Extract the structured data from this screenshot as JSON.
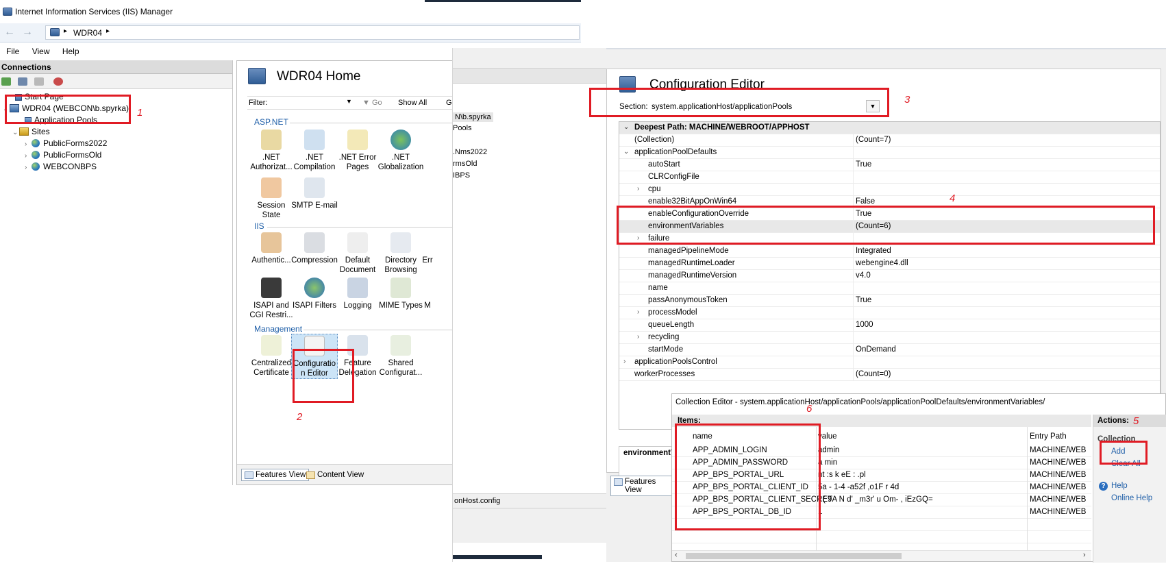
{
  "window": {
    "title": "Internet Information Services (IIS) Manager",
    "address_crumb": "WDR04"
  },
  "menu": [
    "File",
    "View",
    "Help"
  ],
  "connections": {
    "header": "Connections",
    "tree": {
      "start_page": "Start Page",
      "server": "WDR04 (WEBCON\\b.spyrka)",
      "app_pools": "Application Pools",
      "sites": "Sites",
      "site_items": [
        "PublicForms2022",
        "PublicFormsOld",
        "WEBCONBPS"
      ]
    }
  },
  "home": {
    "title": "WDR04 Home",
    "filter_label": "Filter:",
    "go_label": "Go",
    "show_all_label": "Show All",
    "group_label_partial": "Gro",
    "groups": [
      {
        "name": "ASP.NET",
        "features": [
          ".NET Authorizat...",
          ".NET Compilation",
          ".NET Error Pages",
          ".NET Globalization",
          "Session State",
          "SMTP E-mail"
        ]
      },
      {
        "name": "IIS",
        "features": [
          "Authentic...",
          "Compression",
          "Default Document",
          "Directory Browsing",
          "Err",
          "ISAPI and CGI Restri...",
          "ISAPI Filters",
          "Logging",
          "MIME Types",
          "M"
        ]
      },
      {
        "name": "Management",
        "features": [
          "Centralized Certificate",
          "Configuratio n Editor",
          "Feature Delegation",
          "Shared Configurat..."
        ]
      }
    ],
    "features_view": "Features View",
    "content_view": "Content View"
  },
  "middle": {
    "user_partial": "N\\b.spyrka",
    "pools_partial": "Pools",
    "site_partials": [
      ".Nms2022",
      "rmsOld",
      "IBPS"
    ],
    "config_partial": "onHost.config"
  },
  "config_editor": {
    "title": "Configuration Editor",
    "section_label": "Section:",
    "section_value": "system.applicationHost/applicationPools",
    "deepest_path": "Deepest Path: MACHINE/WEBROOT/APPHOST",
    "rows": [
      {
        "name": "(Collection)",
        "value": "(Count=7)"
      },
      {
        "name": "applicationPoolDefaults",
        "value": ""
      },
      {
        "name": "autoStart",
        "value": "True"
      },
      {
        "name": "CLRConfigFile",
        "value": ""
      },
      {
        "name": "cpu",
        "value": ""
      },
      {
        "name": "enable32BitAppOnWin64",
        "value": "False"
      },
      {
        "name": "enableConfigurationOverride",
        "value": "True"
      },
      {
        "name": "environmentVariables",
        "value": "(Count=6)"
      },
      {
        "name": "failure",
        "value": ""
      },
      {
        "name": "managedPipelineMode",
        "value": "Integrated"
      },
      {
        "name": "managedRuntimeLoader",
        "value": "webengine4.dll"
      },
      {
        "name": "managedRuntimeVersion",
        "value": "v4.0"
      },
      {
        "name": "name",
        "value": ""
      },
      {
        "name": "passAnonymousToken",
        "value": "True"
      },
      {
        "name": "processModel",
        "value": ""
      },
      {
        "name": "queueLength",
        "value": "1000"
      },
      {
        "name": "recycling",
        "value": ""
      },
      {
        "name": "startMode",
        "value": "OnDemand"
      },
      {
        "name": "applicationPoolsControl",
        "value": ""
      },
      {
        "name": "workerProcesses",
        "value": "(Count=0)"
      }
    ],
    "detail_label": "environmentV",
    "features_view": "Features View"
  },
  "collection_editor": {
    "title": "Collection Editor - system.applicationHost/applicationPools/applicationPoolDefaults/environmentVariables/",
    "items_header": "Items:",
    "columns": [
      "name",
      "value",
      "Entry Path"
    ],
    "items": [
      {
        "name": "APP_ADMIN_LOGIN",
        "value": "admin",
        "path": "MACHINE/WEB"
      },
      {
        "name": "APP_ADMIN_PASSWORD",
        "value": "a  min",
        "path": "MACHINE/WEB"
      },
      {
        "name": "APP_BPS_PORTAL_URL",
        "value": "nt  :s  k     eE  :  .pl",
        "path": "MACHINE/WEB"
      },
      {
        "name": "APP_BPS_PORTAL_CLIENT_ID",
        "value": "5a     -  1-4  -a52f  ,o1F   r  4d",
        "path": "MACHINE/WEB"
      },
      {
        "name": "APP_BPS_PORTAL_CLIENT_SECRET",
        "value": "(  ( 9A  N  d'      _m3r'        u  Om-  ,  iEzGQ=",
        "path": "MACHINE/WEB"
      },
      {
        "name": "APP_BPS_PORTAL_DB_ID",
        "value": "1",
        "path": "MACHINE/WEB"
      }
    ],
    "actions_header": "Actions:",
    "actions_group": "Collection",
    "actions": [
      "Add",
      "Clear All",
      "Help",
      "Online Help"
    ]
  },
  "markers": [
    "1",
    "2",
    "3",
    "4",
    "5",
    "6"
  ],
  "colors": {
    "highlight_red": "#e01b24",
    "link_blue": "#1f5fa8",
    "group_header_blue": "#1f5fa8"
  }
}
